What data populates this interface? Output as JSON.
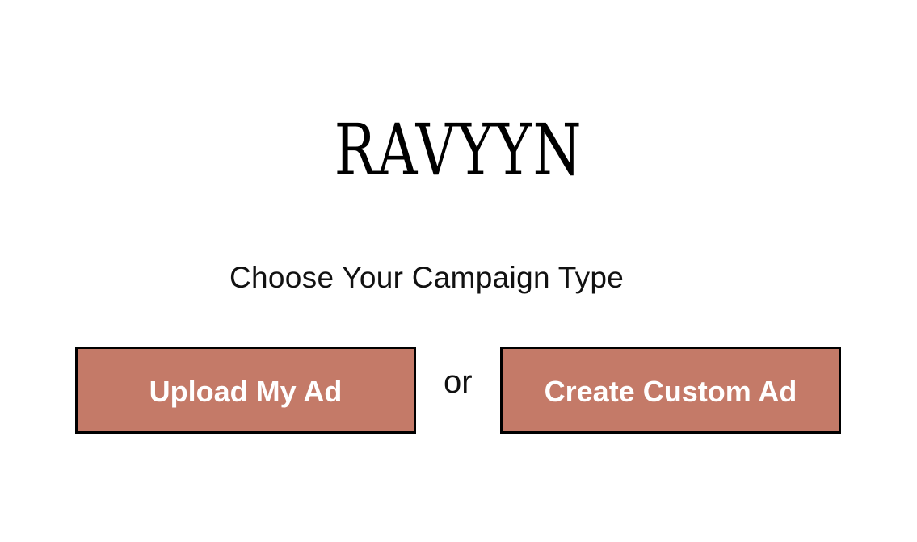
{
  "brand": {
    "logo_text": "RAVYYN"
  },
  "main": {
    "heading": "Choose Your Campaign Type",
    "upload_button_label": "Upload My Ad",
    "separator_text": "or",
    "create_button_label": "Create Custom Ad"
  },
  "colors": {
    "button_fill": "#c47a68",
    "button_border": "#000000",
    "button_text": "#ffffff",
    "background": "#ffffff"
  }
}
